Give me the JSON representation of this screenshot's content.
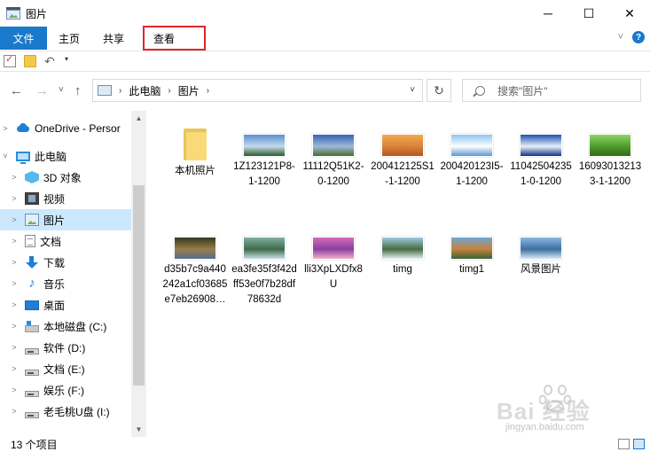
{
  "window": {
    "title": "图片",
    "minimize": "─",
    "maximize": "☐",
    "close": "✕"
  },
  "ribbon": {
    "tabs": [
      {
        "label": "文件",
        "active": true
      },
      {
        "label": "主页"
      },
      {
        "label": "共享"
      },
      {
        "label": "查看",
        "highlighted": true
      }
    ],
    "collapse_icon": "chevron-down-icon",
    "help": "?"
  },
  "qat": {
    "undo": "↶",
    "dropdown": "▾"
  },
  "nav": {
    "back": "←",
    "forward": "→",
    "recent": "˅",
    "up": "↑"
  },
  "address": {
    "chevron": "›",
    "path": [
      "此电脑",
      "图片"
    ],
    "dropdown": "˅",
    "refresh": "↻"
  },
  "search": {
    "placeholder": "搜索\"图片\""
  },
  "sidebar": {
    "items": [
      {
        "label": "OneDrive - Persor",
        "icon": "cloud-icon",
        "expander": ">",
        "selected": false
      },
      {
        "label": "此电脑",
        "icon": "computer-icon",
        "expander": "˅",
        "selected": false
      },
      {
        "label": "3D 对象",
        "icon": "3d-objects-icon",
        "expander": ">",
        "selected": false
      },
      {
        "label": "视频",
        "icon": "video-icon",
        "expander": ">",
        "selected": false
      },
      {
        "label": "图片",
        "icon": "pictures-icon",
        "expander": ">",
        "selected": true
      },
      {
        "label": "文档",
        "icon": "documents-icon",
        "expander": ">",
        "selected": false
      },
      {
        "label": "下载",
        "icon": "downloads-icon",
        "expander": ">",
        "selected": false
      },
      {
        "label": "音乐",
        "icon": "music-icon",
        "expander": ">",
        "selected": false
      },
      {
        "label": "桌面",
        "icon": "desktop-icon",
        "expander": ">",
        "selected": false
      },
      {
        "label": "本地磁盘 (C:)",
        "icon": "system-drive-icon",
        "expander": ">",
        "selected": false
      },
      {
        "label": "软件 (D:)",
        "icon": "drive-icon",
        "expander": ">",
        "selected": false
      },
      {
        "label": "文档 (E:)",
        "icon": "drive-icon",
        "expander": ">",
        "selected": false
      },
      {
        "label": "娱乐 (F:)",
        "icon": "drive-icon",
        "expander": ">",
        "selected": false
      },
      {
        "label": "老毛桃U盘 (I:)",
        "icon": "drive-icon",
        "expander": ">",
        "selected": false
      }
    ],
    "scroll_up": "▲",
    "scroll_down": "▼"
  },
  "files": [
    {
      "name": "本机照片",
      "type": "folder"
    },
    {
      "name": "1Z123121P8-1-1200",
      "type": "image",
      "colors": [
        "#5a8fd0",
        "#c6d9ee",
        "#2a5a28"
      ]
    },
    {
      "name": "11112Q51K2-0-1200",
      "type": "image",
      "colors": [
        "#3462b4",
        "#9fb9d9",
        "#4a6a30"
      ]
    },
    {
      "name": "200412125S1-1-1200",
      "type": "image",
      "colors": [
        "#f2a950",
        "#d8823a",
        "#b3581f"
      ]
    },
    {
      "name": "200420123I5-1-1200",
      "type": "image",
      "colors": [
        "#8ec4ee",
        "#ffffff",
        "#5b96cf"
      ]
    },
    {
      "name": "110425042351-0-1200",
      "type": "image",
      "colors": [
        "#1f4fb0",
        "#e9f0fa",
        "#103480"
      ]
    },
    {
      "name": "160930132133-1-1200",
      "type": "image",
      "colors": [
        "#8ed46a",
        "#4f9c2c",
        "#2e6a16"
      ]
    },
    {
      "name": "d35b7c9a440242a1cf03685e7eb26908…",
      "type": "image",
      "colors": [
        "#2f3b20",
        "#9a7c4a",
        "#556d8f"
      ]
    },
    {
      "name": "ea3fe35f3f42dff53e0f7b28df78632d",
      "type": "image",
      "colors": [
        "#7fb0a0",
        "#3f6a4a",
        "#c9dfe6"
      ]
    },
    {
      "name": "lli3XpLXDfx8U",
      "type": "image",
      "colors": [
        "#d56ab8",
        "#8c3fa0",
        "#f3b0c8"
      ]
    },
    {
      "name": "timg",
      "type": "image",
      "colors": [
        "#9ec8e0",
        "#456c40",
        "#e2eef6"
      ]
    },
    {
      "name": "timg1",
      "type": "image",
      "colors": [
        "#6da7d6",
        "#c7823a",
        "#37623a"
      ]
    },
    {
      "name": "风景图片",
      "type": "image",
      "colors": [
        "#8ab7e4",
        "#3d6fa2",
        "#d9e8f5"
      ]
    }
  ],
  "status": {
    "item_count": "13 个项目"
  },
  "watermark": {
    "brand": "Bai 经验",
    "url": "jingyan.baidu.com"
  },
  "colors": {
    "accent": "#1979ca",
    "selection": "#cce8ff",
    "highlight_box": "#e0262a"
  }
}
